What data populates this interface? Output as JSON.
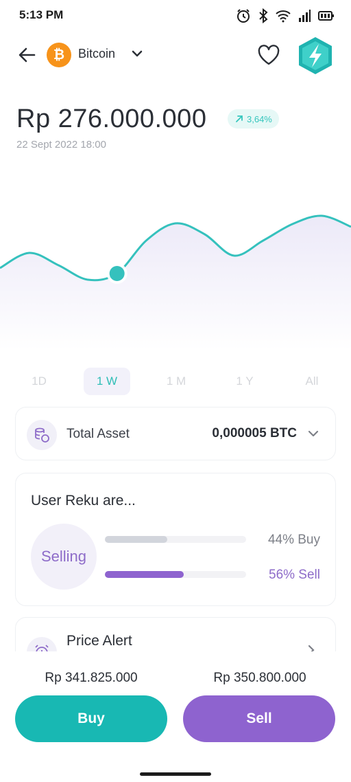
{
  "status_bar": {
    "time": "5:13 PM",
    "icons": [
      "alarm-icon",
      "bluetooth-icon",
      "wifi-icon",
      "signal-icon",
      "battery-icon"
    ]
  },
  "header": {
    "coin_symbol_glyph": "₿",
    "coin_name": "Bitcoin",
    "icons": [
      "back-arrow-icon",
      "chevron-down-icon",
      "heart-icon",
      "lightning-avatar-icon"
    ]
  },
  "price": {
    "value": "Rp 276.000.000",
    "change": "3,64%",
    "change_direction_icon": "arrow-up-right-icon",
    "date": "22 Sept 2022 18:00"
  },
  "chart_data": {
    "type": "line",
    "series": [
      {
        "x": [
          0,
          1,
          2,
          3,
          4,
          5,
          6,
          7,
          8,
          9,
          10,
          11,
          12
        ],
        "values": [
          276.0,
          278.2,
          276.4,
          274.3,
          275.2,
          280.0,
          282.5,
          280.9,
          277.8,
          280.0,
          282.4,
          283.6,
          282.0
        ]
      }
    ],
    "highlighted_index": 4,
    "line_color": "#35c1bd",
    "ylim": [
      270,
      290
    ],
    "grid": false
  },
  "ranges": {
    "items": [
      "1D",
      "1 W",
      "1 M",
      "1 Y",
      "All"
    ],
    "active": "1 W"
  },
  "total_asset": {
    "label": "Total Asset",
    "value": "0,000005 BTC",
    "icon": "coins-icon"
  },
  "sentiment": {
    "title": "User Reku are...",
    "status": "Selling",
    "buy_label": "44% Buy",
    "sell_label": "56% Sell",
    "buy_fraction": 0.44,
    "sell_fraction": 0.56
  },
  "price_alert": {
    "title": "Price Alert",
    "icon": "alarm-clock-icon"
  },
  "actions": {
    "buy_price": "Rp 341.825.000",
    "sell_price": "Rp 350.800.000",
    "buy_label": "Buy",
    "sell_label": "Sell"
  },
  "colors": {
    "teal": "#18b8b3",
    "purple": "#8e63cf",
    "bitcoin_orange": "#f7931a"
  }
}
